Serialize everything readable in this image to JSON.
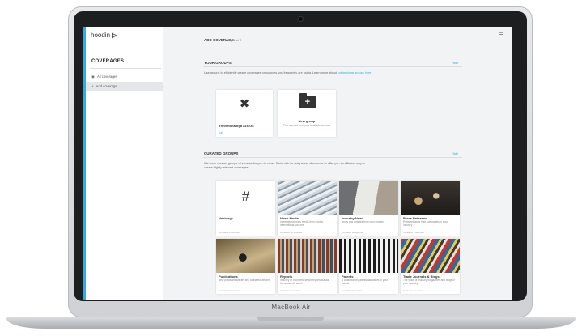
{
  "device": {
    "brand": "MacBook Air"
  },
  "app": {
    "logo": "hoodin"
  },
  "sidebar": {
    "title": "COVERAGES",
    "items": [
      {
        "label": "All coverages",
        "active": false
      },
      {
        "label": "Add coverage",
        "active": true
      }
    ]
  },
  "header": {
    "title": "ADD COVERAGE",
    "step": "Step 1 of 2"
  },
  "your_groups": {
    "title": "YOUR GROUPS",
    "link": "Hide",
    "desc": "Use groups to efficiently create coverages on sources you frequently are using. Learn more about",
    "desc_link": "customizing groups here",
    "cards": [
      {
        "title": "Yhhhmdnadfga a1f3Gk",
        "foot": "Edit"
      },
      {
        "title": "New group",
        "desc": "Pick sources from your available sources"
      }
    ]
  },
  "curated_groups": {
    "title": "CURATED GROUPS",
    "link": "Hide",
    "desc": "We have curated groups of sources for you to cover. Each with its unique set of sources to offer you an efficient way to create highly relevant coverages.",
    "cards": [
      {
        "title": "Hashtags",
        "desc": "",
        "foot": "Contains 0 sources",
        "symbol": "#"
      },
      {
        "title": "News Media",
        "desc": "International news media from trust to international sources",
        "foot": "Contains 48 sources"
      },
      {
        "title": "Industry News",
        "desc": "News and updates from your industry",
        "foot": "Contains 38 sources"
      },
      {
        "title": "Press Releases",
        "desc": "Press releases from companies in your industry",
        "foot": "Contains 9 sources"
      },
      {
        "title": "Publications",
        "desc": "New published articles and academic articles",
        "foot": "Contains 0 sources"
      },
      {
        "title": "Reports",
        "desc": "Industry or economic sector reports outside the academic world",
        "foot": "Contains 0 sources"
      },
      {
        "title": "Patents",
        "desc": "A collection of patents databases in your industry",
        "foot": "Contains 0 sources"
      },
      {
        "title": "Trade Journals & Blogs",
        "desc": "The voice of industry magazines and blogs in your industry",
        "foot": "Contains 0 sources"
      }
    ]
  },
  "colors": {
    "accent": "#3aa8d8",
    "sidebar_active": "#e4e6e9",
    "content_bg": "#f2f3f5"
  }
}
